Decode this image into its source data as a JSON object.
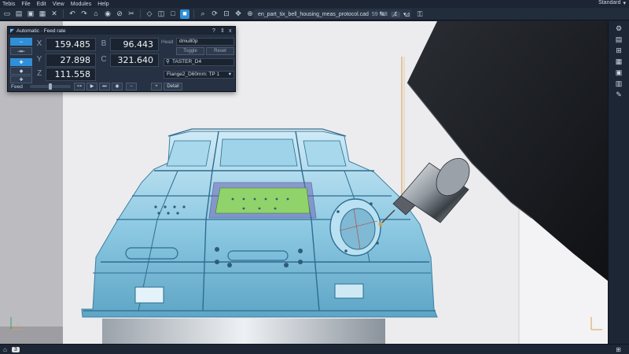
{
  "menubar": {
    "items": [
      "Tebis",
      "File",
      "Edit",
      "View",
      "Modules",
      "Help"
    ],
    "workspace": "Standard",
    "workspace_arrow": "▾"
  },
  "toolbar": {
    "icons": [
      "new-file-icon",
      "open-folder-icon",
      "save-icon",
      "save-as-icon",
      "close-icon",
      "undo-icon",
      "redo-icon",
      "home-icon",
      "eye-icon",
      "hide-icon",
      "cut-icon",
      "iso-view-icon",
      "view-cube-icon",
      "front-view-icon",
      "shaded-view-icon",
      "zoom-icon",
      "rotate-icon",
      "fit-icon",
      "pan-icon",
      "measure-icon",
      "pen-icon",
      "brush-icon",
      "ruler-icon",
      "lock-icon"
    ]
  },
  "file_tab": {
    "name": "en_part_tix_bell_housing_meas_protocol.cad",
    "size": "59 MB",
    "count": "1",
    "menu_arrow": "▾"
  },
  "nc_panel": {
    "title": "Automatic · Feed rate",
    "help": "?",
    "pin": "⇕",
    "close": "x",
    "x_label": "X",
    "x_value": "159.485",
    "y_label": "Y",
    "y_value": "27.898",
    "z_label": "Z",
    "z_value": "111.558",
    "b_label": "B",
    "b_value": "96.443",
    "c_label": "C",
    "c_value": "321.640",
    "head_label": "Head",
    "head_value": "dmu80p",
    "toggle_label": "Toggle",
    "reset_label": "Reset",
    "tool_value": "TASTER_D4",
    "frame_value": "Flange2_D60mm: TP 1",
    "feed_label": "Feed",
    "detail_label": "Detail"
  },
  "bottombar": {
    "page": "3"
  },
  "colors": {
    "accent": "#2f8fd8",
    "panel_bg": "#263243",
    "part_blue": "#8ecbe3",
    "probe_path": "#d9a04a",
    "green_face": "#8fd36a"
  }
}
